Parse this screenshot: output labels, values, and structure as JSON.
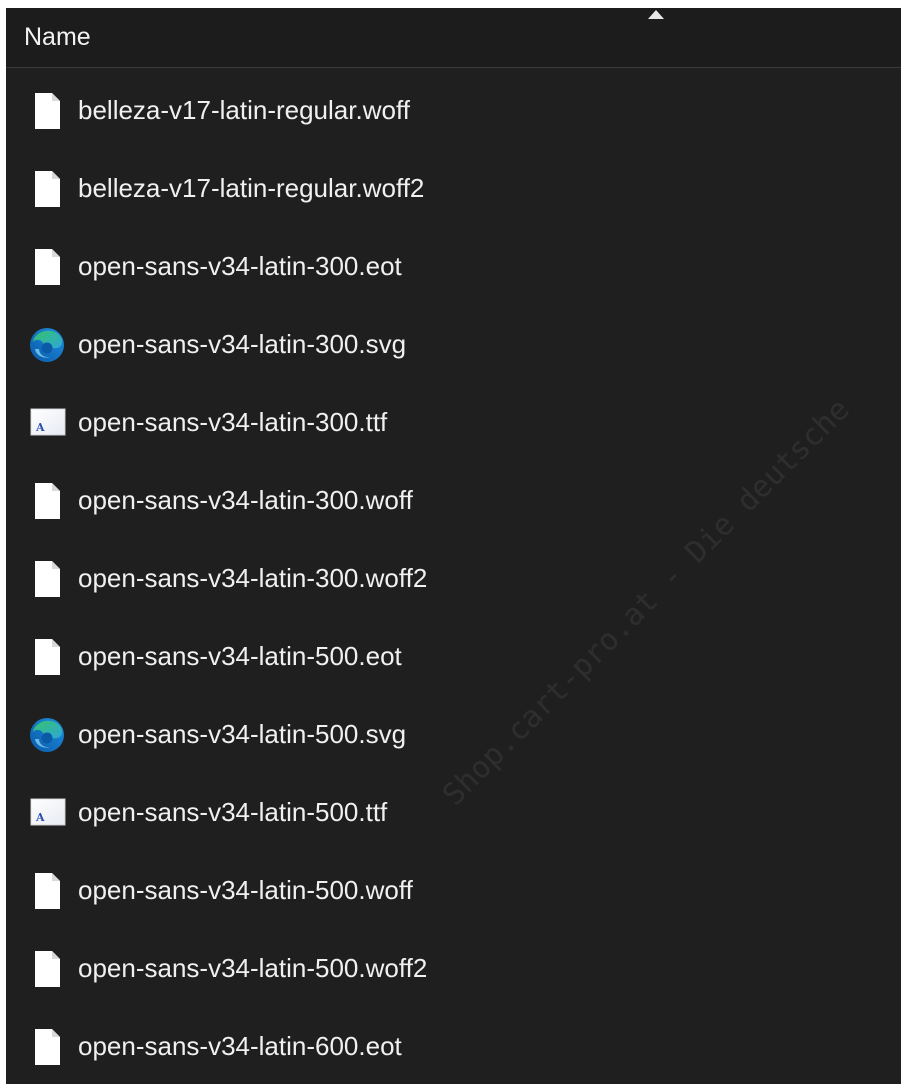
{
  "header": {
    "name_label": "Name",
    "sort_icon": "sort-ascending-icon"
  },
  "files": [
    {
      "name": "belleza-v17-latin-regular.woff",
      "icon": "blank-file-icon"
    },
    {
      "name": "belleza-v17-latin-regular.woff2",
      "icon": "blank-file-icon"
    },
    {
      "name": "open-sans-v34-latin-300.eot",
      "icon": "blank-file-icon"
    },
    {
      "name": "open-sans-v34-latin-300.svg",
      "icon": "edge-browser-icon"
    },
    {
      "name": "open-sans-v34-latin-300.ttf",
      "icon": "font-file-icon"
    },
    {
      "name": "open-sans-v34-latin-300.woff",
      "icon": "blank-file-icon"
    },
    {
      "name": "open-sans-v34-latin-300.woff2",
      "icon": "blank-file-icon"
    },
    {
      "name": "open-sans-v34-latin-500.eot",
      "icon": "blank-file-icon"
    },
    {
      "name": "open-sans-v34-latin-500.svg",
      "icon": "edge-browser-icon"
    },
    {
      "name": "open-sans-v34-latin-500.ttf",
      "icon": "font-file-icon"
    },
    {
      "name": "open-sans-v34-latin-500.woff",
      "icon": "blank-file-icon"
    },
    {
      "name": "open-sans-v34-latin-500.woff2",
      "icon": "blank-file-icon"
    },
    {
      "name": "open-sans-v34-latin-600.eot",
      "icon": "blank-file-icon"
    }
  ],
  "watermark": "Shop.cart-pro.at - Die deutsche",
  "colors": {
    "background": "#1f1f1f",
    "text": "#f0f0f0",
    "edge_blue": "#1a8ad4",
    "edge_green": "#4cc25a"
  }
}
